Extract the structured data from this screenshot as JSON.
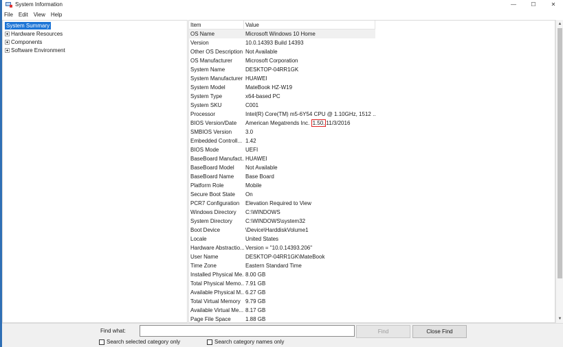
{
  "window": {
    "title": "System Information",
    "controls": [
      "—",
      "☐",
      "✕"
    ]
  },
  "menu": [
    "File",
    "Edit",
    "View",
    "Help"
  ],
  "tree": {
    "selected": "System Summary",
    "items": [
      "Hardware Resources",
      "Components",
      "Software Environment"
    ]
  },
  "table": {
    "columns": [
      "Item",
      "Value"
    ],
    "highlighted_row": "OS Name",
    "rows": [
      {
        "item": "OS Name",
        "value": "Microsoft Windows 10 Home"
      },
      {
        "item": "Version",
        "value": "10.0.14393 Build 14393"
      },
      {
        "item": "Other OS Description",
        "value": "Not Available"
      },
      {
        "item": "OS Manufacturer",
        "value": "Microsoft Corporation"
      },
      {
        "item": "System Name",
        "value": "DESKTOP-04RR1GK"
      },
      {
        "item": "System Manufacturer",
        "value": "HUAWEI"
      },
      {
        "item": "System Model",
        "value": "MateBook HZ-W19"
      },
      {
        "item": "System Type",
        "value": "x64-based PC"
      },
      {
        "item": "System SKU",
        "value": "C001"
      },
      {
        "item": "Processor",
        "value": "Intel(R) Core(TM) m5-6Y54 CPU @ 1.10GHz, 1512 ..."
      },
      {
        "item": "BIOS Version/Date",
        "value_prefix": "American Megatrends Inc.",
        "value_mark": "1.50,",
        "value_suffix": "11/3/2016"
      },
      {
        "item": "SMBIOS Version",
        "value": "3.0"
      },
      {
        "item": "Embedded Controll...",
        "value": "1.42"
      },
      {
        "item": "BIOS Mode",
        "value": "UEFI"
      },
      {
        "item": "BaseBoard Manufact...",
        "value": "HUAWEI"
      },
      {
        "item": "BaseBoard Model",
        "value": "Not Available"
      },
      {
        "item": "BaseBoard Name",
        "value": "Base Board"
      },
      {
        "item": "Platform Role",
        "value": "Mobile"
      },
      {
        "item": "Secure Boot State",
        "value": "On"
      },
      {
        "item": "PCR7 Configuration",
        "value": "Elevation Required to View"
      },
      {
        "item": "Windows Directory",
        "value": "C:\\WINDOWS"
      },
      {
        "item": "System Directory",
        "value": "C:\\WINDOWS\\system32"
      },
      {
        "item": "Boot Device",
        "value": "\\Device\\HarddiskVolume1"
      },
      {
        "item": "Locale",
        "value": "United States"
      },
      {
        "item": "Hardware Abstractio...",
        "value": "Version = \"10.0.14393.206\""
      },
      {
        "item": "User Name",
        "value": "DESKTOP-04RR1GK\\MateBook"
      },
      {
        "item": "Time Zone",
        "value": "Eastern Standard Time"
      },
      {
        "item": "Installed Physical Me...",
        "value": "8.00 GB"
      },
      {
        "item": "Total Physical Memo...",
        "value": "7.91 GB"
      },
      {
        "item": "Available Physical M...",
        "value": "6.27 GB"
      },
      {
        "item": "Total Virtual Memory",
        "value": "9.79 GB"
      },
      {
        "item": "Available Virtual Me...",
        "value": "8.17 GB"
      },
      {
        "item": "Page File Space",
        "value": "1.88 GB"
      }
    ]
  },
  "find": {
    "label": "Find what:",
    "value": "",
    "find_button": "Find",
    "close_find_button": "Close Find",
    "search_selected_label": "Search selected category only",
    "search_names_label": "Search category names only"
  },
  "icons": {
    "app": "system-information-icon",
    "expand": "plus-expander-icon",
    "scroll_up": "chevron-up-icon",
    "scroll_down": "chevron-down-icon"
  },
  "colors": {
    "selection": "#1c74d6",
    "highlight_box": "#e02020",
    "window_edge": "#2f6fb5"
  }
}
